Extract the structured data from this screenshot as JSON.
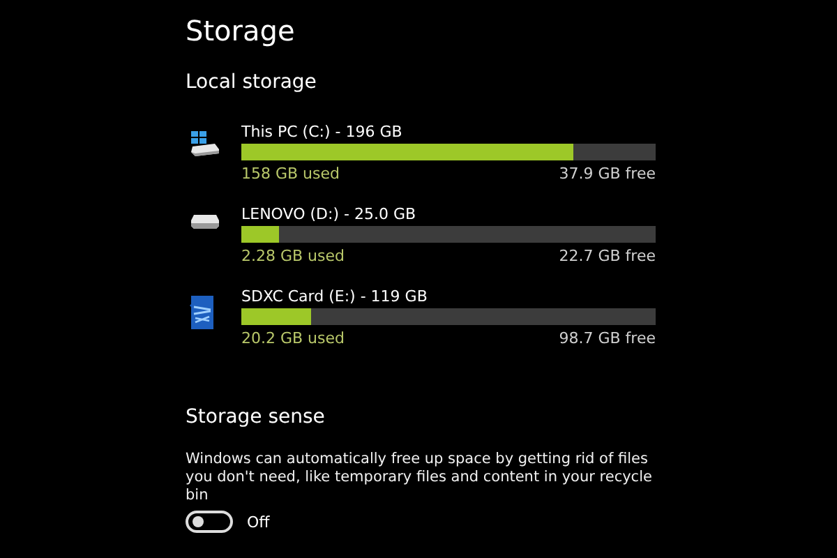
{
  "title": "Storage",
  "local_storage": {
    "heading": "Local storage",
    "drives": [
      {
        "kind": "system",
        "name": "This PC (C:) - 196 GB",
        "level": 0.8,
        "used": "158 GB used",
        "free": "37.9 GB free"
      },
      {
        "kind": "usb",
        "name": "LENOVO (D:) - 25.0 GB",
        "level": 0.09,
        "used": "2.28 GB used",
        "free": "22.7 GB free"
      },
      {
        "kind": "sd",
        "name": "SDXC Card (E:) - 119 GB",
        "level": 0.17,
        "used": "20.2 GB used",
        "free": "98.7 GB free"
      }
    ]
  },
  "storage_sense": {
    "heading": "Storage sense",
    "description": "Windows can automatically free up space by getting rid of files you don't need, like temporary files and content in your recycle bin",
    "toggle": {
      "on": false,
      "label": "Off"
    }
  }
}
